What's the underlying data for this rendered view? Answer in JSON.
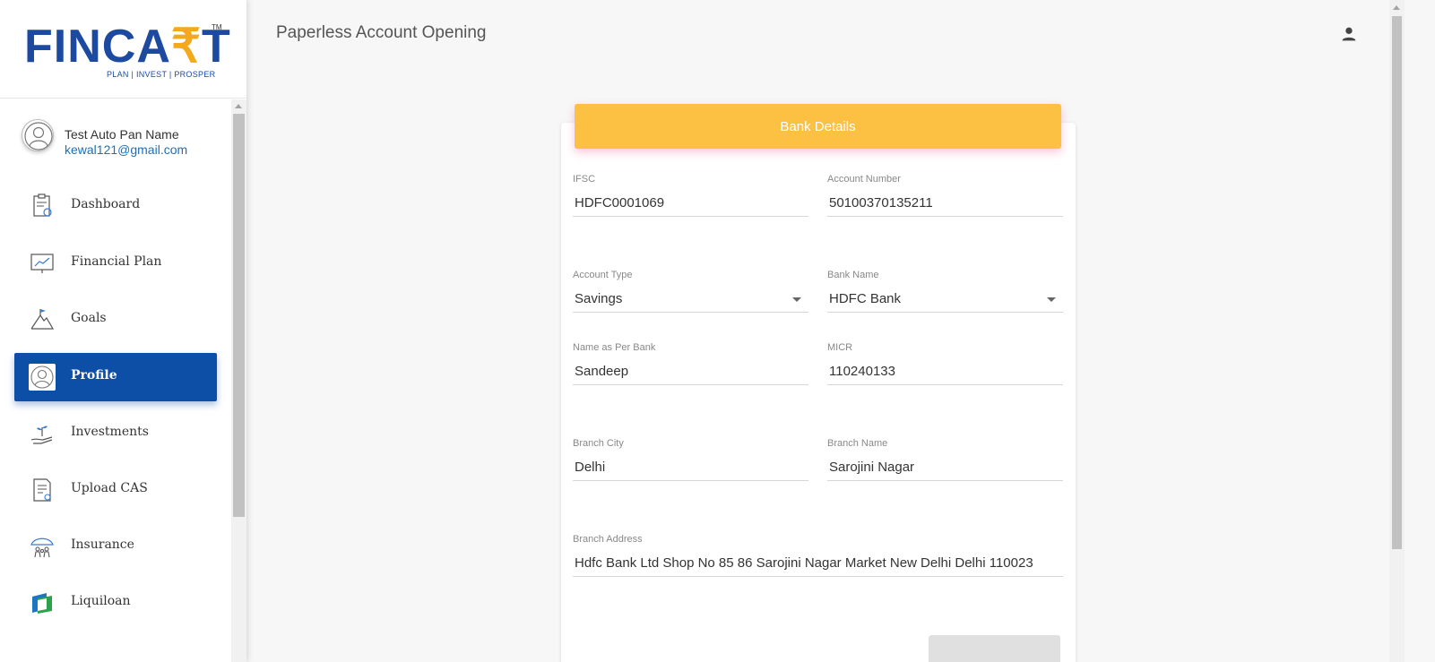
{
  "app": {
    "page_title": "Paperless Account Opening"
  },
  "logo": {
    "brand": "FINCART",
    "tagline": "PLAN | INVEST | PROSPER",
    "tm": "TM",
    "colors": {
      "primary": "#1c4aa1",
      "accent": "#f4a81d"
    }
  },
  "user": {
    "name": "Test Auto Pan Name",
    "email": "kewal121@gmail.com"
  },
  "sidebar": {
    "items": [
      {
        "label": "Dashboard",
        "icon": "dashboard-icon",
        "active": false
      },
      {
        "label": "Financial Plan",
        "icon": "chart-icon",
        "active": false
      },
      {
        "label": "Goals",
        "icon": "mountain-flag-icon",
        "active": false
      },
      {
        "label": "Profile",
        "icon": "user-profile-icon",
        "active": true
      },
      {
        "label": "Investments",
        "icon": "plant-hand-icon",
        "active": false
      },
      {
        "label": "Upload CAS",
        "icon": "document-icon",
        "active": false
      },
      {
        "label": "Insurance",
        "icon": "umbrella-family-icon",
        "active": false
      },
      {
        "label": "Liquiloan",
        "icon": "liquiloan-logo-icon",
        "active": false
      }
    ]
  },
  "card": {
    "title": "Bank Details",
    "header_color": "#fcc043",
    "fields": {
      "ifsc": {
        "label": "IFSC",
        "value": "HDFC0001069"
      },
      "account_number": {
        "label": "Account Number",
        "value": "50100370135211"
      },
      "account_type": {
        "label": "Account Type",
        "value": "Savings"
      },
      "bank_name": {
        "label": "Bank Name",
        "value": "HDFC Bank"
      },
      "name_as_per_bank": {
        "label": "Name as Per Bank",
        "value": "Sandeep"
      },
      "micr": {
        "label": "MICR",
        "value": "110240133"
      },
      "branch_city": {
        "label": "Branch City",
        "value": "Delhi"
      },
      "branch_name": {
        "label": "Branch Name",
        "value": "Sarojini Nagar"
      },
      "branch_address": {
        "label": "Branch Address",
        "value": "Hdfc Bank Ltd Shop No 85 86 Sarojini Nagar Market New Delhi Delhi 110023"
      }
    }
  }
}
